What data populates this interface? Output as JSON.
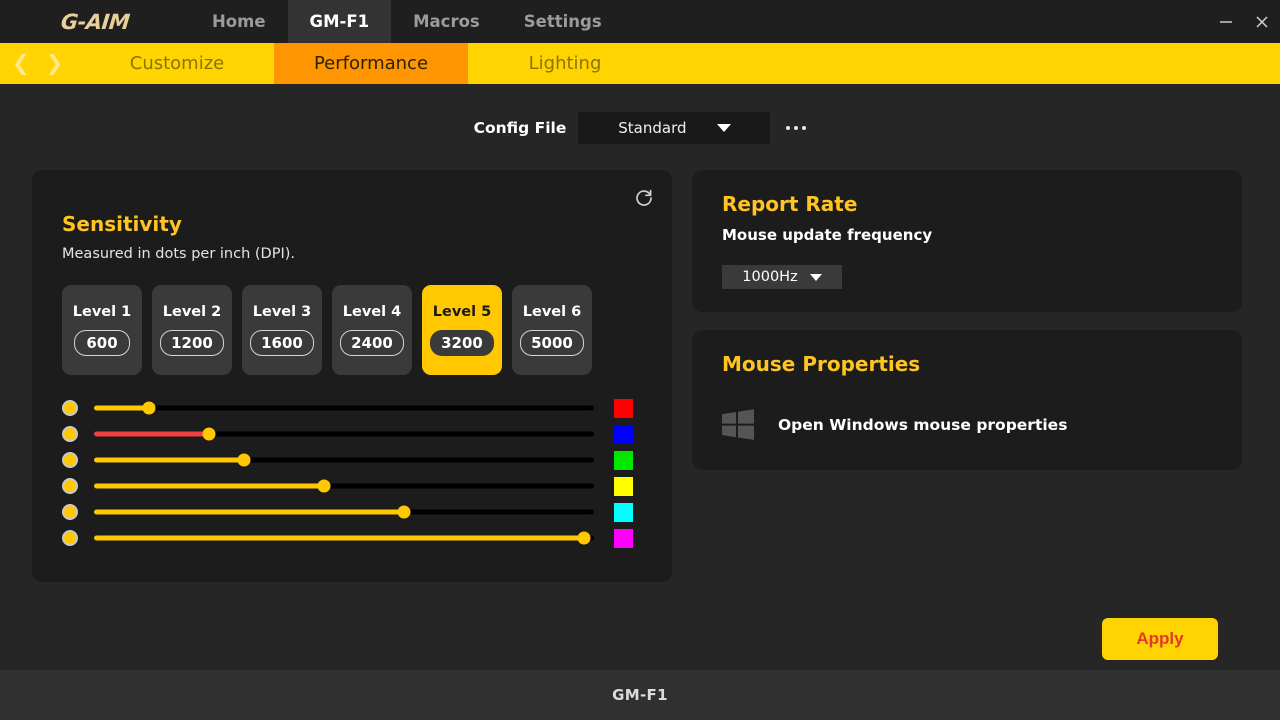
{
  "window": {
    "logo_text": "G-AIM",
    "minimize_label": "–",
    "close_label": "×",
    "nav_tabs": [
      {
        "label": "Home",
        "active": false
      },
      {
        "label": "GM-F1",
        "active": true
      },
      {
        "label": "Macros",
        "active": false
      },
      {
        "label": "Settings",
        "active": false
      }
    ]
  },
  "subbar": {
    "prev_arrow": "❮",
    "next_arrow": "❯",
    "bar_color": "#FFD400",
    "active_color": "#FF9500",
    "tabs": [
      {
        "label": "Customize",
        "active": false
      },
      {
        "label": "Performance",
        "active": true
      },
      {
        "label": "Lighting",
        "active": false
      }
    ]
  },
  "config": {
    "label": "Config File",
    "selected": "Standard",
    "options": [
      "Standard"
    ],
    "more_label": "…"
  },
  "sensitivity": {
    "title": "Sensitivity",
    "subtitle": "Measured in dots per inch (DPI).",
    "reset_icon": "refresh-icon",
    "accent_color": "#FFC422",
    "levels": [
      {
        "name": "Level 1",
        "dpi": "600",
        "active": false
      },
      {
        "name": "Level 2",
        "dpi": "1200",
        "active": false
      },
      {
        "name": "Level 3",
        "dpi": "1600",
        "active": false
      },
      {
        "name": "Level 4",
        "dpi": "2400",
        "active": false
      },
      {
        "name": "Level 5",
        "dpi": "3200",
        "active": true
      },
      {
        "name": "Level 6",
        "dpi": "5000",
        "active": false
      }
    ],
    "sliders": [
      {
        "level": "Level 1",
        "percent": 11,
        "fill_color": "#FFC800",
        "swatch": "#FF0000"
      },
      {
        "level": "Level 2",
        "percent": 23,
        "fill_color": "#F04040",
        "swatch": "#0000FF"
      },
      {
        "level": "Level 3",
        "percent": 30,
        "fill_color": "#FFC800",
        "swatch": "#00E800"
      },
      {
        "level": "Level 4",
        "percent": 46,
        "fill_color": "#FFC800",
        "swatch": "#FFFF00"
      },
      {
        "level": "Level 5",
        "percent": 62,
        "fill_color": "#FFC800",
        "swatch": "#00FFFF"
      },
      {
        "level": "Level 6",
        "percent": 98,
        "fill_color": "#FFC800",
        "swatch": "#FF00FF"
      }
    ]
  },
  "report_rate": {
    "title": "Report Rate",
    "subtitle": "Mouse update frequency",
    "selected": "1000Hz",
    "options": [
      "1000Hz"
    ]
  },
  "mouse_properties": {
    "title": "Mouse Properties",
    "link_label": "Open Windows mouse properties",
    "icon": "windows-logo-icon"
  },
  "actions": {
    "apply_label": "Apply",
    "apply_bg": "#FFD400",
    "apply_fg": "#E8362A"
  },
  "footer": {
    "device_name": "GM-F1"
  }
}
